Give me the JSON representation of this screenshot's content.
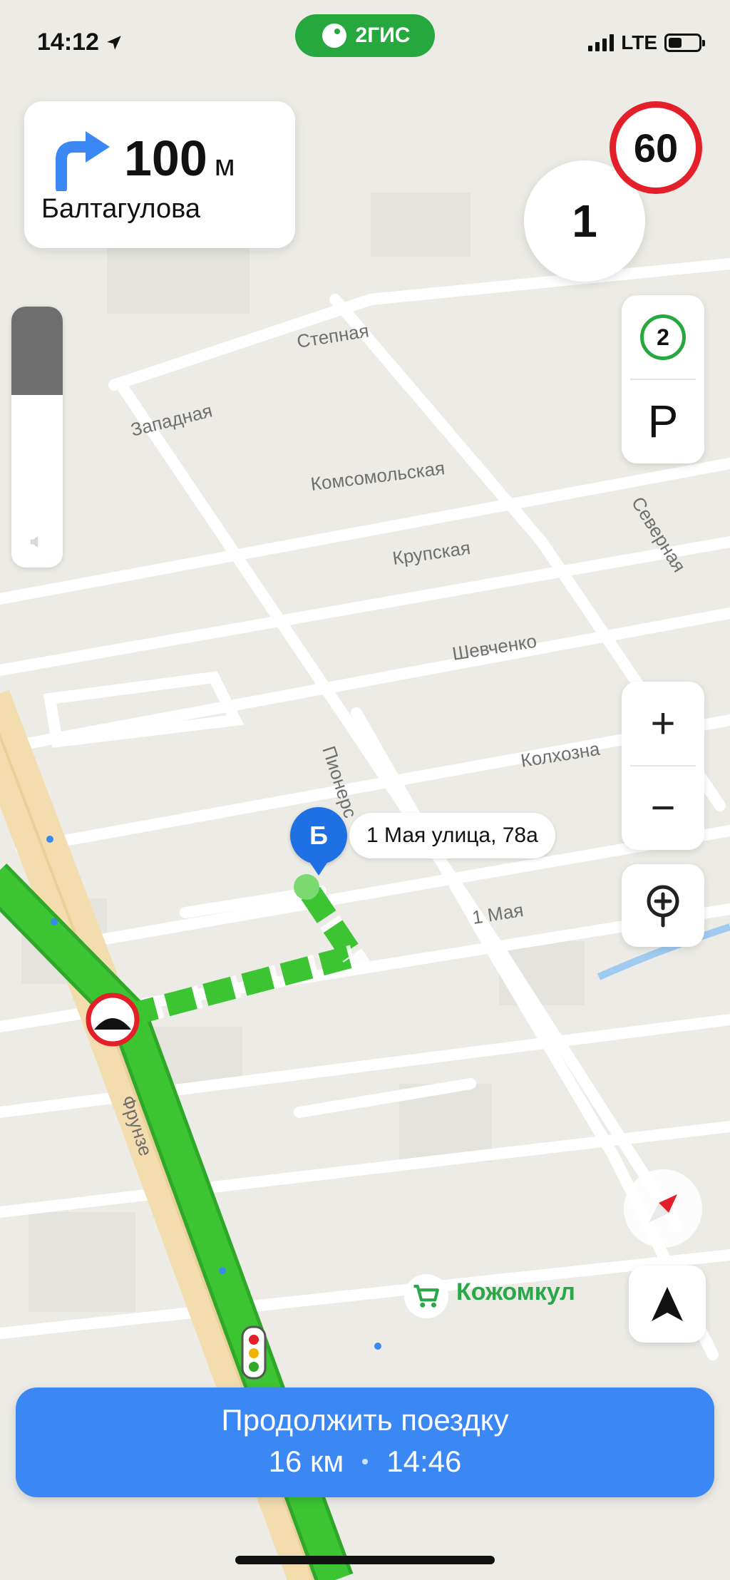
{
  "status_bar": {
    "time": "14:12",
    "network": "LTE",
    "brand": "2ГИС",
    "battery_level": 0.45
  },
  "maneuver": {
    "distance": "100",
    "unit": "м",
    "street": "Балтагулова",
    "icon": "turn-right-arrow-icon"
  },
  "speed": {
    "limit": "60",
    "current": "1"
  },
  "controls": {
    "traffic_level": "2",
    "parking_label": "P",
    "zoom_in": "+",
    "zoom_out": "−",
    "volume_level": 0.34
  },
  "map": {
    "streets": [
      "Степная",
      "Западная",
      "Комсомольская",
      "Крупская",
      "Шевченко",
      "Колхозна",
      "Пионерс",
      "1 Мая",
      "Фрунзе",
      "Северная"
    ],
    "destination": {
      "marker": "Б",
      "label": "1 Мая улица, 78а"
    },
    "poi": {
      "name": "Кожомкул",
      "icon": "shopping-cart-icon"
    }
  },
  "bottom": {
    "action_label": "Продолжить поездку",
    "distance": "16 км",
    "eta": "14:46"
  },
  "colors": {
    "route": "#3cc432",
    "accent": "#3b88f5",
    "brand": "#27a83f",
    "speed_ring": "#e3202a"
  }
}
